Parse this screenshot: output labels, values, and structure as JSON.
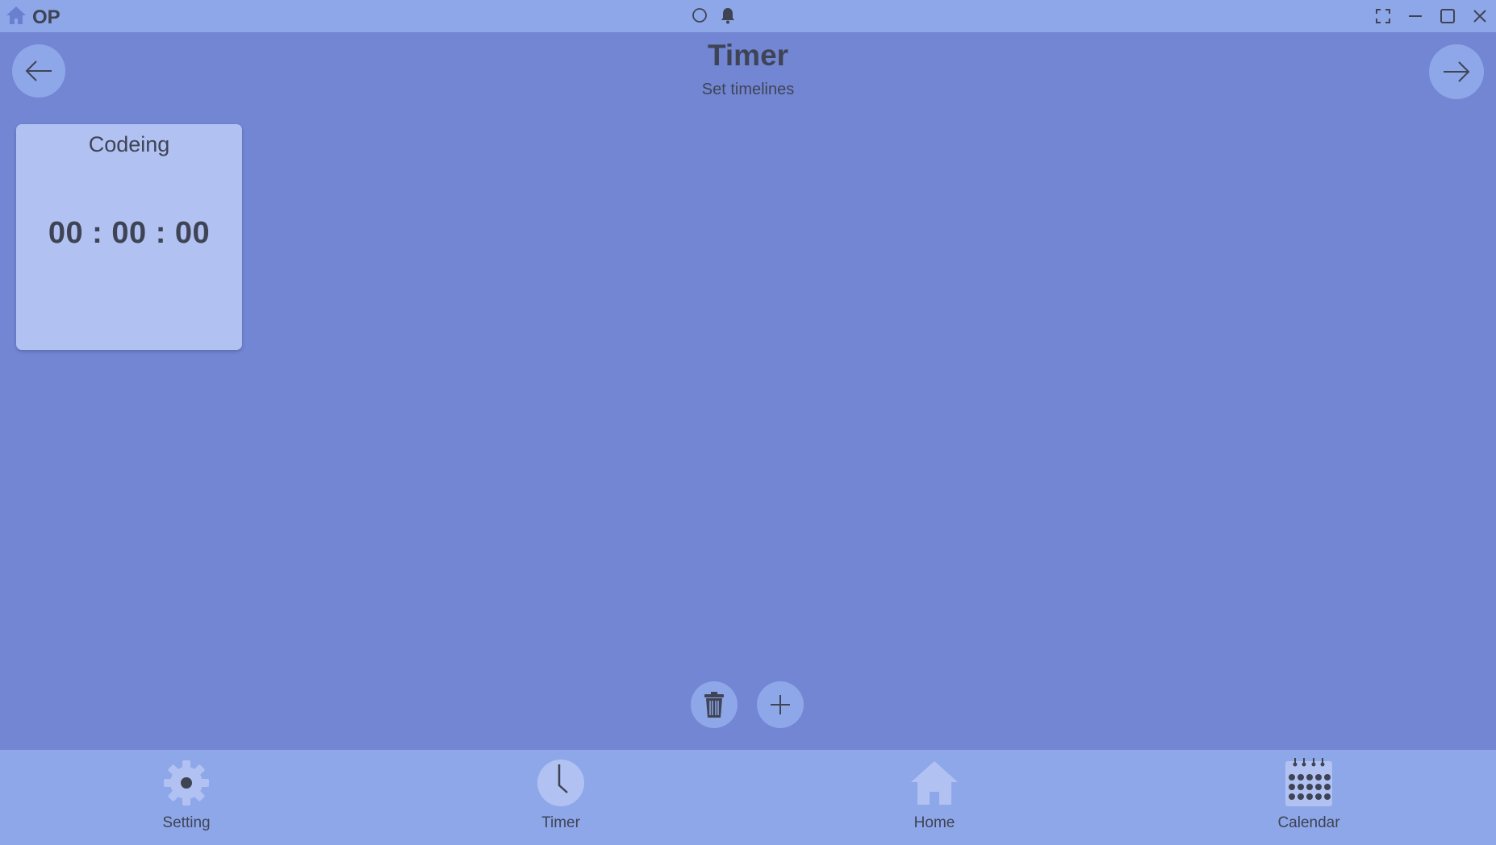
{
  "titlebar": {
    "app_name": "OP"
  },
  "header": {
    "title": "Timer",
    "subtitle": "Set timelines"
  },
  "timers": [
    {
      "name": "Codeing",
      "time": "00 : 00 : 00"
    }
  ],
  "bottom_nav": {
    "items": [
      {
        "label": "Setting",
        "icon": "gear-icon"
      },
      {
        "label": "Timer",
        "icon": "clock-icon"
      },
      {
        "label": "Home",
        "icon": "home-icon"
      },
      {
        "label": "Calendar",
        "icon": "calendar-icon"
      }
    ]
  },
  "colors": {
    "background": "#7286d3",
    "bar": "#8ea7e9",
    "card": "#b1c2f2",
    "text": "#3f4455"
  }
}
